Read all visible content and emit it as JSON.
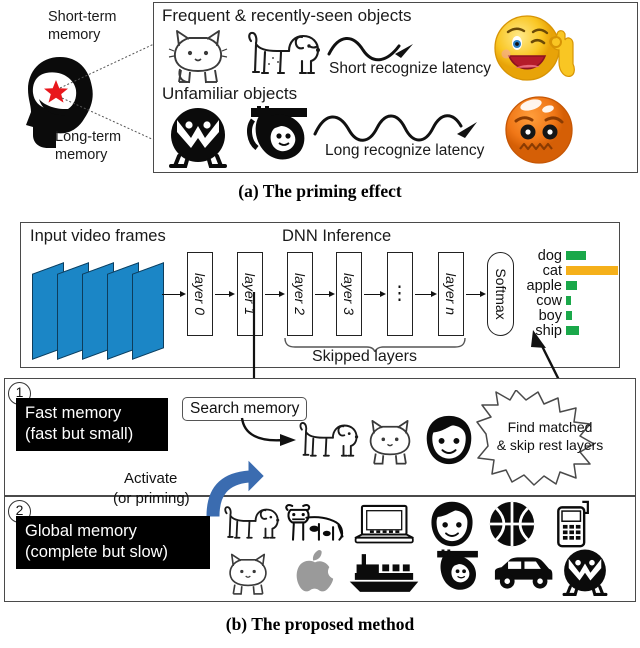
{
  "figure": {
    "caption_a": "(a) The priming effect",
    "caption_b": "(b) The proposed method"
  },
  "panel_a": {
    "short_term_label": "Short-term\nmemory",
    "short_term_line1": "Short-term",
    "short_term_line2": "memory",
    "long_term_line1": "Long-term",
    "long_term_line2": "memory",
    "frequent_title": "Frequent & recently-seen objects",
    "unfamiliar_title": "Unfamiliar objects",
    "short_latency": "Short recognize latency",
    "long_latency": "Long recognize latency",
    "familiar_icons": [
      "cat-icon",
      "dog-icon"
    ],
    "unfamiliar_icons": [
      "owl-icon",
      "sloth-icon"
    ],
    "happy_face": "winking-happy-face-emoji",
    "ok_hand": "ok-hand-emoji",
    "worried_face": "worried-orange-face-emoji",
    "star_icon": "red-star-icon",
    "head_icon": "human-head-silhouette-icon"
  },
  "panel_dnn": {
    "input_title": "Input video frames",
    "inference_title": "DNN Inference",
    "skipped_label": "Skipped layers",
    "frames_count": 5,
    "layers": [
      "layer 0",
      "layer 1",
      "layer 2",
      "layer 3",
      "⋮",
      "layer n"
    ],
    "softmax_label": "Softmax",
    "frame_color": "#1b86c6"
  },
  "chart_data": {
    "type": "bar",
    "title": "",
    "categories": [
      "dog",
      "cat",
      "apple",
      "cow",
      "boy",
      "ship"
    ],
    "values": [
      0.38,
      1.0,
      0.21,
      0.09,
      0.11,
      0.25
    ],
    "colors": [
      "#1aa84a",
      "#f5b01a",
      "#1aa84a",
      "#1aa84a",
      "#1aa84a",
      "#1aa84a"
    ],
    "highlight_category": "cat",
    "highlight_color": "#f5b01a",
    "base_color": "#1aa84a",
    "xlabel": "",
    "ylabel": "",
    "xlim": [
      0,
      1
    ],
    "grid": false,
    "legend": "none",
    "orientation": "horizontal"
  },
  "panel_fast": {
    "number": "1",
    "title_line1": "Fast memory",
    "title_line2": "(fast but small)",
    "search_memory": "Search memory",
    "activate_line1": "Activate",
    "activate_line2": "(or priming)",
    "burst_line1": "Find matched",
    "burst_line2": "& skip rest layers",
    "icons": [
      "dog-icon",
      "cat-icon",
      "boy-icon"
    ]
  },
  "panel_global": {
    "number": "2",
    "title_line1": "Global memory",
    "title_line2": "(complete but slow)",
    "icons_row1": [
      "dog-icon",
      "cow-icon",
      "laptop-icon",
      "boy-icon",
      "basketball-icon",
      "mobile-phone-icon"
    ],
    "icons_row2": [
      "cat-icon",
      "apple-logo-icon",
      "ship-icon",
      "sloth-icon",
      "car-icon",
      "owl-icon"
    ]
  }
}
